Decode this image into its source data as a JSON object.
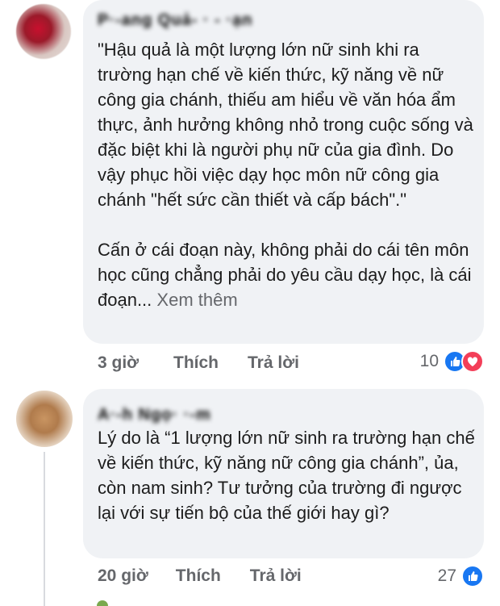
{
  "comments": [
    {
      "author": "P·-ang Quả- · - ·ạn",
      "paragraphs": [
        "\"Hậu quả là một lượng lớn nữ sinh khi ra trường hạn chế về kiến thức, kỹ năng về nữ công gia chánh, thiếu am hiểu về văn hóa ẩm thực, ảnh hưởng không nhỏ trong cuộc sống và đặc biệt khi là người phụ nữ của gia đình. Do vậy phục hồi việc dạy học môn nữ công gia chánh \"hết sức cần thiết và cấp bách\".\"",
        "Cấn ở cái đoạn này, không phải do cái tên môn học cũng chẳng phải do yêu cầu dạy học, là cái đoạn..."
      ],
      "see_more": "Xem thêm",
      "time": "3 giờ",
      "like_label": "Thích",
      "reply_label": "Trả lời",
      "reaction_count": "10",
      "reactions": [
        "like-icon",
        "love-icon"
      ]
    },
    {
      "author": "A·-h Ngọ· ·-m",
      "paragraphs": [
        "Lý do là “1 lượng lớn nữ sinh ra trường hạn chế về kiến thức, kỹ năng nữ công gia chánh”, ủa, còn nam sinh? Tư tưởng của trường đi ngược lại với sự tiến bộ của thế giới hay gì?"
      ],
      "time": "20 giờ",
      "like_label": "Thích",
      "reply_label": "Trả lời",
      "reaction_count": "27",
      "reactions": [
        "like-icon"
      ]
    }
  ],
  "colors": {
    "bubble": "#f0f2f5",
    "meta": "#65676b",
    "like": "#1877f2",
    "love": "#f33e58"
  }
}
